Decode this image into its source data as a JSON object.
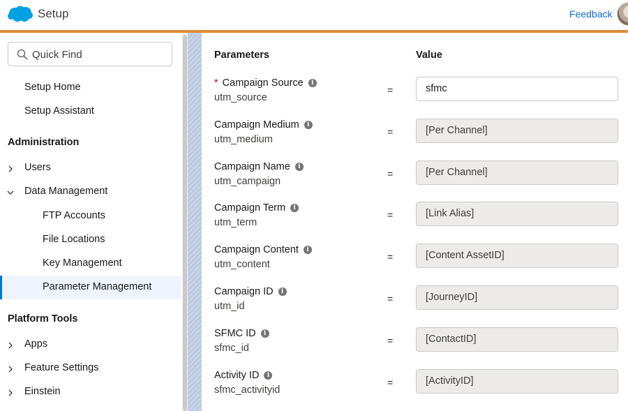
{
  "header": {
    "app_title": "Setup",
    "feedback_label": "Feedback",
    "accent_color": "#dd8a35"
  },
  "sidebar": {
    "quick_find_placeholder": "Quick Find",
    "top_items": [
      "Setup Home",
      "Setup Assistant"
    ],
    "sections": [
      {
        "title": "Administration",
        "items": [
          {
            "label": "Users",
            "expanded": false
          },
          {
            "label": "Data Management",
            "expanded": true,
            "children": [
              "FTP Accounts",
              "File Locations",
              "Key Management",
              "Parameter Management"
            ]
          }
        ]
      },
      {
        "title": "Platform Tools",
        "items": [
          {
            "label": "Apps",
            "expanded": false
          },
          {
            "label": "Feature Settings",
            "expanded": false
          },
          {
            "label": "Einstein",
            "expanded": false
          }
        ]
      }
    ],
    "active_item": "Parameter Management"
  },
  "table": {
    "col_parameters": "Parameters",
    "col_value": "Value",
    "equals_sign": "=",
    "rows": [
      {
        "label": "Campaign Source",
        "key": "utm_source",
        "value": "sfmc",
        "required": true,
        "editable": true
      },
      {
        "label": "Campaign Medium",
        "key": "utm_medium",
        "value": "[Per Channel]",
        "required": false,
        "editable": false
      },
      {
        "label": "Campaign Name",
        "key": "utm_campaign",
        "value": "[Per Channel]",
        "required": false,
        "editable": false
      },
      {
        "label": "Campaign Term",
        "key": "utm_term",
        "value": "[Link Alias]",
        "required": false,
        "editable": false
      },
      {
        "label": "Campaign Content",
        "key": "utm_content",
        "value": "[Content AssetID]",
        "required": false,
        "editable": false
      },
      {
        "label": "Campaign ID",
        "key": "utm_id",
        "value": "[JourneyID]",
        "required": false,
        "editable": false
      },
      {
        "label": "SFMC ID",
        "key": "sfmc_id",
        "value": "[ContactID]",
        "required": false,
        "editable": false
      },
      {
        "label": "Activity ID",
        "key": "sfmc_activityid",
        "value": "[ActivityID]",
        "required": false,
        "editable": false
      }
    ]
  }
}
